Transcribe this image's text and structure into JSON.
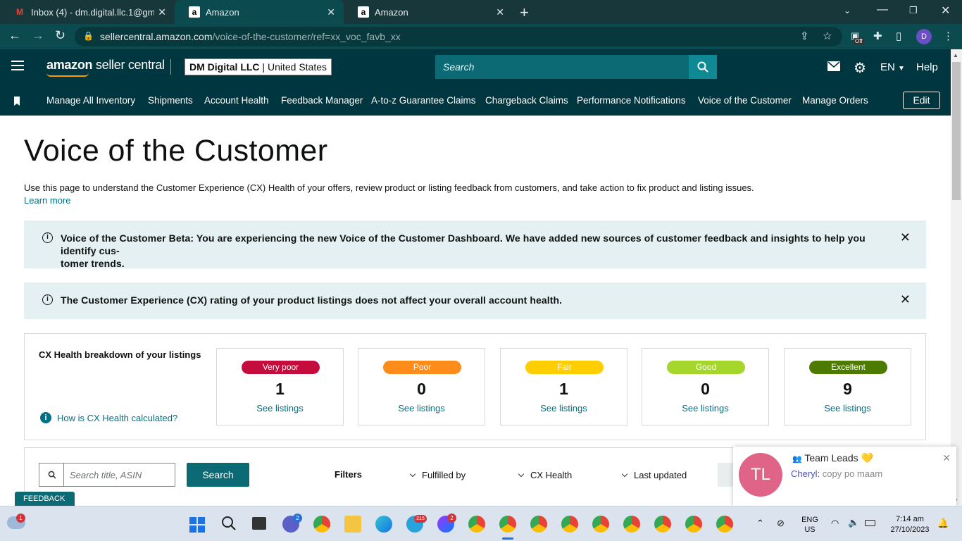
{
  "browser": {
    "tabs": [
      {
        "title": "Inbox (4) - dm.digital.llc.1@gma",
        "favicon": "gmail-icon"
      },
      {
        "title": "Amazon",
        "favicon": "amazon-icon"
      },
      {
        "title": "Amazon",
        "favicon": "amazon-icon"
      }
    ],
    "url_host": "sellercentral.amazon.com",
    "url_path": "/voice-of-the-customer/ref=xx_voc_favb_xx",
    "profile_initial": "D",
    "extension_badge": "Off"
  },
  "header": {
    "logo_bold": "amazon",
    "logo_light": " seller central",
    "account_name": "DM Digital LLC",
    "account_region": "United States",
    "search_placeholder": "Search",
    "language": "EN",
    "help": "Help"
  },
  "nav": {
    "items": [
      "Manage All Inventory",
      "Shipments",
      "Account Health",
      "Feedback Manager",
      "A-to-z Guarantee Claims",
      "Chargeback Claims",
      "Performance Notifications",
      "Voice of the Customer",
      "Manage Orders"
    ],
    "edit": "Edit"
  },
  "main": {
    "title": "Voice of the Customer",
    "intro": "Use this page to understand the Customer Experience (CX) Health of your offers, review product or listing feedback from customers, and take action to fix product and listing issues.",
    "learn_more": "Learn more",
    "alert1_line1": "Voice of the Customer Beta: You are experiencing the new Voice of the Customer Dashboard. We have added new sources of customer feedback and insights to help you identify cus-",
    "alert1_line2": "tomer trends.",
    "alert2": "The Customer Experience (CX) rating of your product listings does not affect your overall account health."
  },
  "cx": {
    "heading": "CX Health breakdown of your listings",
    "how_link": "How is CX Health calculated?",
    "see_label": "See listings",
    "cards": [
      {
        "label": "Very poor",
        "count": "1",
        "color": "#c40d3c",
        "text_color": "#ffffff"
      },
      {
        "label": "Poor",
        "count": "0",
        "color": "#fe8c1a",
        "text_color": "#ffffff"
      },
      {
        "label": "Fair",
        "count": "1",
        "color": "#ffce00",
        "text_color": "#ffffff"
      },
      {
        "label": "Good",
        "count": "0",
        "color": "#a5d62c",
        "text_color": "#ffffff"
      },
      {
        "label": "Excellent",
        "count": "9",
        "color": "#4d7b00",
        "text_color": "#ffffff"
      }
    ]
  },
  "search_panel": {
    "placeholder": "Search title, ASIN",
    "button": "Search",
    "filters_label": "Filters",
    "dropdowns": [
      "Fulfilled by",
      "CX Health",
      "Last updated"
    ]
  },
  "feedback_tab": "FEEDBACK",
  "toast": {
    "avatar": "TL",
    "group": "Team Leads 💛",
    "sender": "Cheryl:",
    "message": " copy po maam"
  },
  "taskbar": {
    "lang_top": "ENG",
    "lang_bottom": "US",
    "time": "7:14 am",
    "date": "27/10/2023",
    "weather_badge": "1",
    "telegram_badge": "215",
    "messenger_badge": "2",
    "meet_badge": "2"
  },
  "colors": {
    "header_bg": "#00363f",
    "link": "#007185",
    "accent": "#0b6a73",
    "alert_bg": "#e4f0f1"
  }
}
